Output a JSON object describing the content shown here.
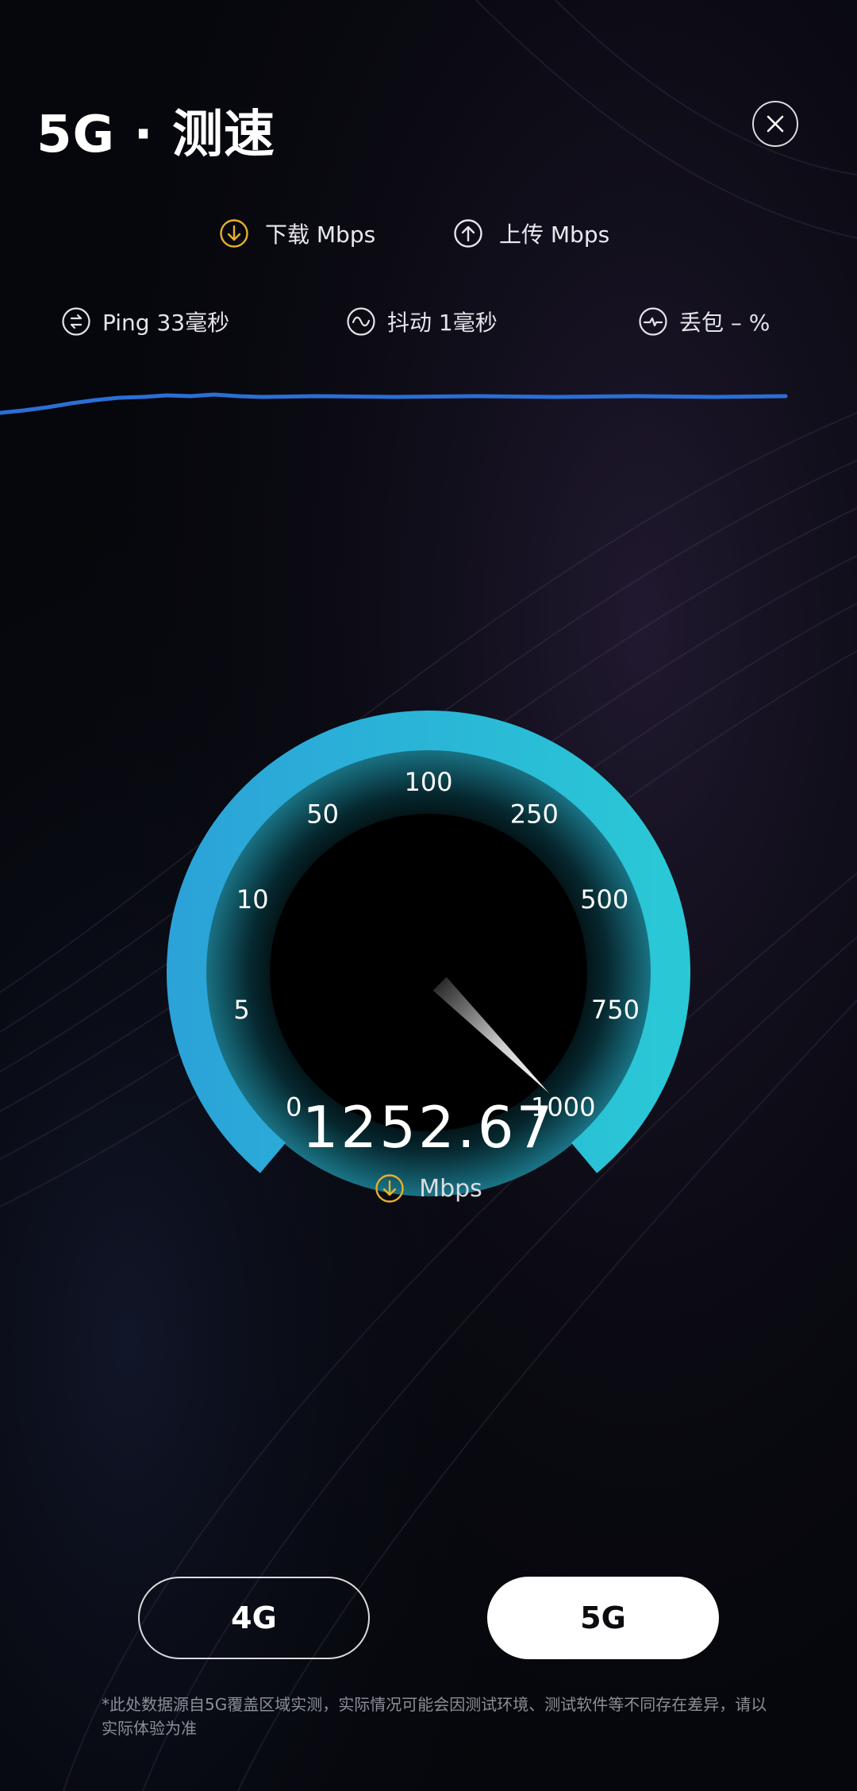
{
  "header": {
    "title": "5G · 测速",
    "close_icon": "close-icon"
  },
  "legend": {
    "download_label": "下载 Mbps",
    "upload_label": "上传 Mbps",
    "download_icon": "download-arrow-icon",
    "upload_icon": "upload-arrow-icon",
    "accent_color": "#e9b12b"
  },
  "metrics": {
    "ping_label": "Ping 33毫秒",
    "jitter_label": "抖动  1毫秒",
    "loss_label": "丢包  –  %"
  },
  "gauge": {
    "scale_labels": [
      "0",
      "5",
      "10",
      "50",
      "100",
      "250",
      "500",
      "750",
      "1000"
    ],
    "needle_value": 1000,
    "speed_value": "1252.67",
    "unit": "Mbps",
    "arc_color_start": "#2ba3d8",
    "arc_color_end": "#2ac8d6"
  },
  "network_toggle": {
    "options": [
      "4G",
      "5G"
    ],
    "selected": "5G"
  },
  "footer": {
    "disclaimer": "*此处数据源自5G覆盖区域实测，实际情况可能会因测试环境、测试软件等不同存在差异，请以实际体验为准"
  }
}
